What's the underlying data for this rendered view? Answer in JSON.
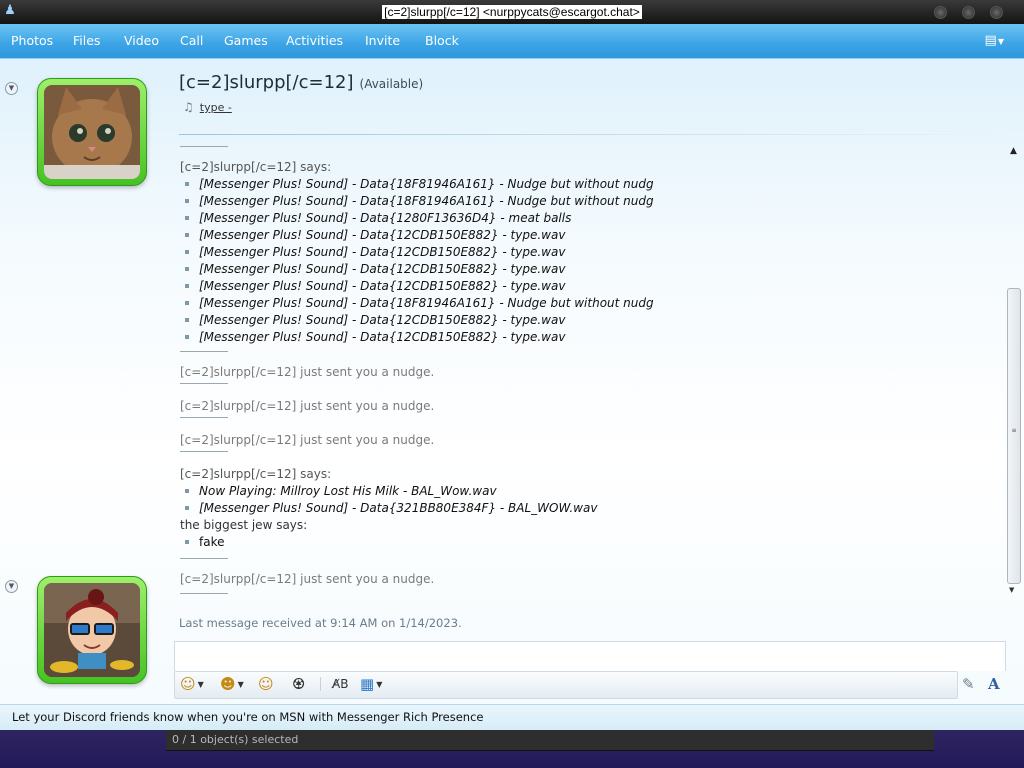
{
  "window": {
    "title": "[c=2]slurpp[/c=12] <nurppycats@escargot.chat>"
  },
  "menu": {
    "items": [
      "Photos",
      "Files",
      "Video",
      "Call",
      "Games",
      "Activities",
      "Invite",
      "Block"
    ]
  },
  "contact": {
    "name": "[c=2]slurpp[/c=12]",
    "status": "(Available)",
    "personal_message": "type -"
  },
  "conversation": {
    "first_block": {
      "sender_line": "[c=2]slurpp[/c=12] says:",
      "messages": [
        "[Messenger Plus! Sound] - Data{18F81946A161} - Nudge but without nudg",
        "[Messenger Plus! Sound] - Data{18F81946A161} - Nudge but without nudg",
        "[Messenger Plus! Sound] - Data{1280F13636D4} - meat balls",
        "[Messenger Plus! Sound] - Data{12CDB150E882} - type.wav",
        "[Messenger Plus! Sound] - Data{12CDB150E882} - type.wav",
        "[Messenger Plus! Sound] - Data{12CDB150E882} - type.wav",
        "[Messenger Plus! Sound] - Data{12CDB150E882} - type.wav",
        "[Messenger Plus! Sound] - Data{18F81946A161} - Nudge but without nudg",
        "[Messenger Plus! Sound] - Data{12CDB150E882} - type.wav",
        "[Messenger Plus! Sound] - Data{12CDB150E882} - type.wav"
      ]
    },
    "nudges": [
      "[c=2]slurpp[/c=12] just sent you a nudge.",
      "[c=2]slurpp[/c=12] just sent you a nudge.",
      "[c=2]slurpp[/c=12] just sent you a nudge."
    ],
    "second_block": {
      "sender_line": "[c=2]slurpp[/c=12] says:",
      "messages": [
        "Now Playing: Millroy Lost His Milk - BAL_Wow.wav",
        "[Messenger Plus! Sound] - Data{321BB80E384F} - BAL_WOW.wav"
      ],
      "reply_sender_line": "the biggest jew says:",
      "reply_messages": [
        "fake"
      ]
    },
    "final_nudge": "[c=2]slurpp[/c=12] just sent you a nudge.",
    "last_received": "Last message received at 9:14 AM on 1/14/2023."
  },
  "status_bar": {
    "text": "Let your Discord friends know when you're on MSN with Messenger Rich Presence"
  },
  "taskbar": {
    "text": "0 / 1 object(s) selected"
  },
  "icons": {
    "app": "msn-people-icon",
    "layout": "layout-menu-icon",
    "music": "music-note-icon",
    "emoticon": "smiley-icon",
    "wink": "wink-icon",
    "nudge": "nudge-icon",
    "voice_clip": "voice-clip-icon",
    "spell": "spell-check-icon",
    "background": "background-icon",
    "handwriting": "handwriting-pen-icon",
    "font": "font-icon"
  },
  "colors": {
    "menubar": "#3ea6e6",
    "frame_green": "#45c223"
  }
}
